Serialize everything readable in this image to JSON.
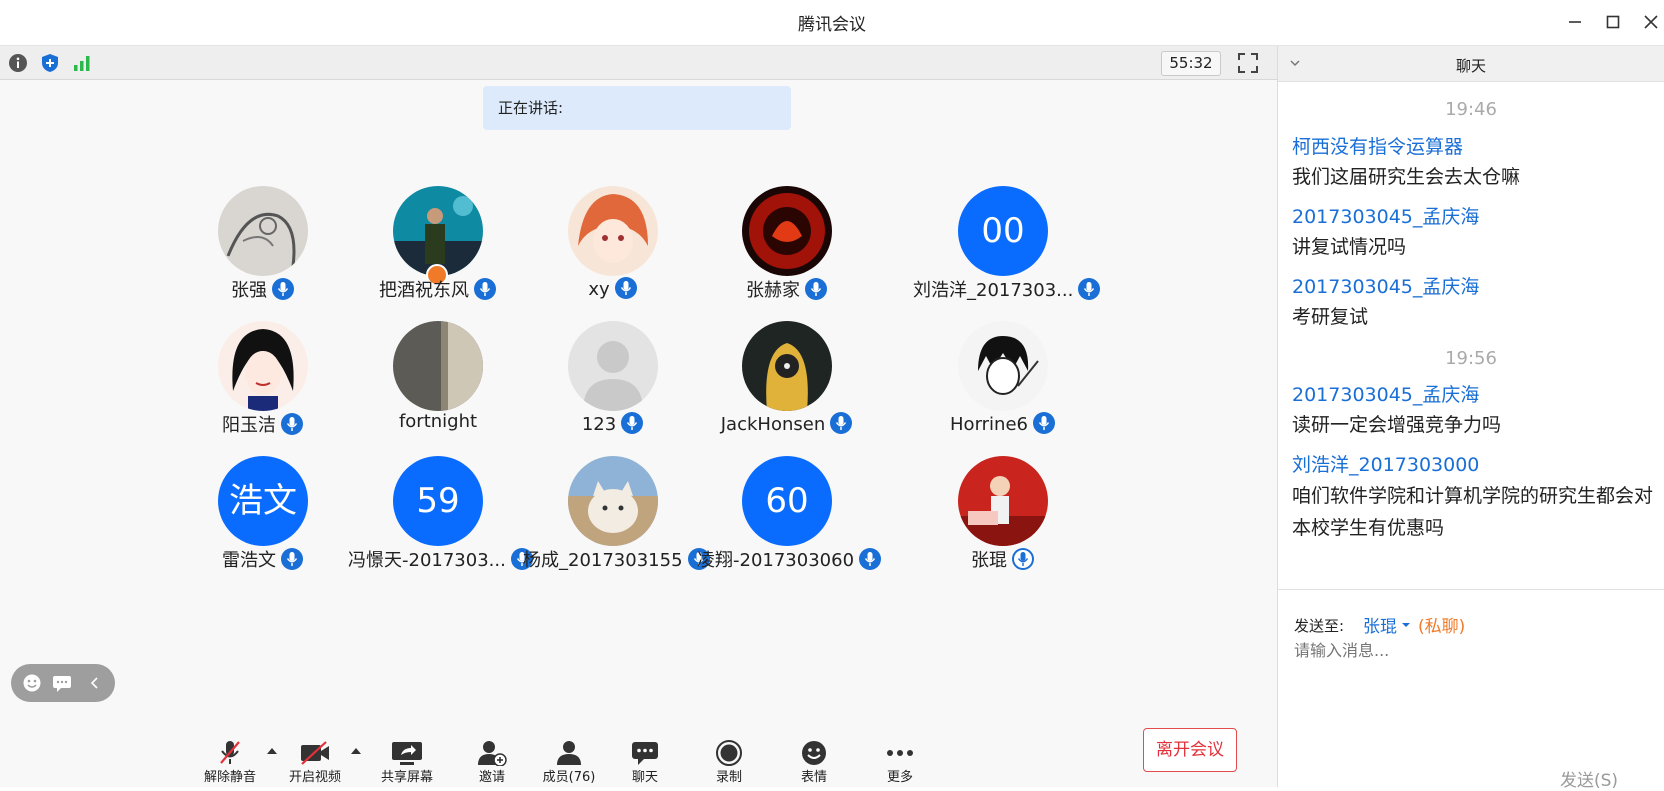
{
  "window": {
    "title": "腾讯会议",
    "minimize": "—",
    "maximize": "☐",
    "close": "✕"
  },
  "infobar": {
    "timer": "55:32",
    "info_icon": "info-icon",
    "shield_icon": "shield-icon",
    "signal_icon": "signal-bars-icon"
  },
  "speaking": {
    "label": "正在讲话:"
  },
  "participants": [
    {
      "name": "张强",
      "avatar_text": "",
      "muted": false
    },
    {
      "name": "把酒祝东风",
      "avatar_text": "",
      "muted": false,
      "host": true
    },
    {
      "name": "xy",
      "avatar_text": "",
      "muted": false
    },
    {
      "name": "张赫家",
      "avatar_text": "",
      "muted": false
    },
    {
      "name": "刘浩洋_2017303...",
      "avatar_text": "00",
      "muted": false
    },
    {
      "name": "阳玉洁",
      "avatar_text": "",
      "muted": false
    },
    {
      "name": "fortnight",
      "avatar_text": "",
      "muted": null
    },
    {
      "name": "123",
      "avatar_text": "",
      "muted": false
    },
    {
      "name": "JackHonsen",
      "avatar_text": "",
      "muted": false
    },
    {
      "name": "Horrine6",
      "avatar_text": "",
      "muted": false
    },
    {
      "name": "雷浩文",
      "avatar_text": "浩文",
      "muted": false
    },
    {
      "name": "冯憬天-2017303...",
      "avatar_text": "59",
      "muted": false
    },
    {
      "name": "杨成_2017303155",
      "avatar_text": "",
      "muted": false
    },
    {
      "name": "凌翔-2017303060",
      "avatar_text": "60",
      "muted": false
    },
    {
      "name": "张琨",
      "avatar_text": "",
      "muted": false,
      "speaking": true
    }
  ],
  "toolbar": {
    "unmute": "解除静音",
    "start_video": "开启视频",
    "share_screen": "共享屏幕",
    "invite": "邀请",
    "members": "成员(76)",
    "chat": "聊天",
    "record": "录制",
    "emoji": "表情",
    "more": "更多",
    "leave": "离开会议"
  },
  "chat": {
    "title": "聊天",
    "messages": [
      {
        "type": "time",
        "text": "19:46"
      },
      {
        "type": "msg",
        "sender": "柯西没有指令运算器",
        "text": "我们这届研究生会去太仓嘛"
      },
      {
        "type": "msg",
        "sender": "2017303045_孟庆海",
        "text": "讲复试情况吗"
      },
      {
        "type": "msg",
        "sender": "2017303045_孟庆海",
        "text": "考研复试"
      },
      {
        "type": "time",
        "text": "19:56"
      },
      {
        "type": "msg",
        "sender": "2017303045_孟庆海",
        "text": "读研一定会增强竞争力吗"
      },
      {
        "type": "msg",
        "sender": "刘浩洋_2017303000",
        "text": "咱们软件学院和计算机学院的研究生都会对本校学生有优惠吗"
      }
    ],
    "send_to_label": "发送至:",
    "recipient": "张琨",
    "private_label": "(私聊)",
    "input_placeholder": "请输入消息...",
    "send_label": "发送(S)"
  },
  "colors": {
    "accent": "#0a6cff",
    "link": "#1a6fd6",
    "leave": "#e2313a",
    "private": "#f07a28"
  }
}
